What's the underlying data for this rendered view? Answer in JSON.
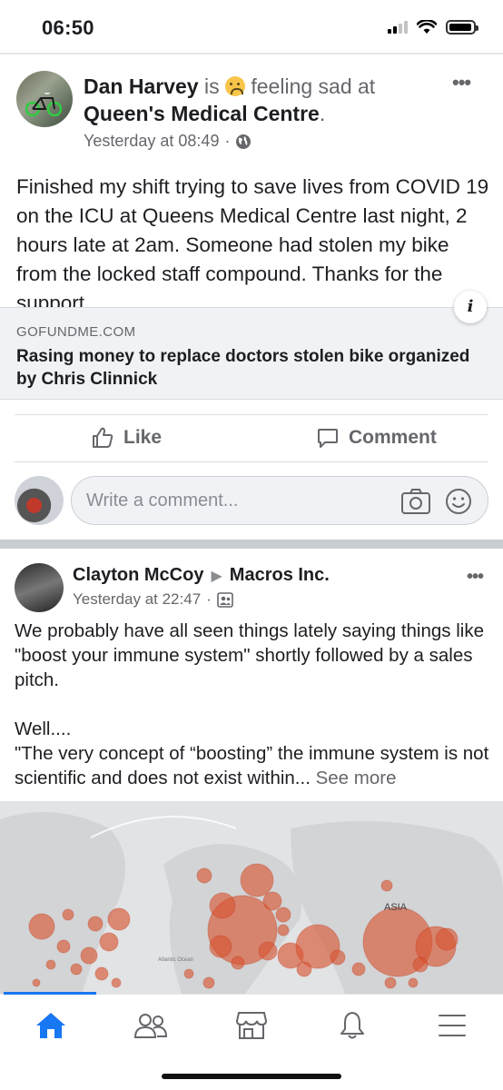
{
  "status_bar": {
    "time": "06:50",
    "battery_level": 0.95
  },
  "post1": {
    "author": "Dan Harvey",
    "is_text": "is",
    "feeling": "feeling sad at",
    "feeling_emoji": "sad-face",
    "location": "Queen's Medical Centre",
    "location_suffix": ".",
    "timestamp": "Yesterday at 08:49",
    "separator": "·",
    "privacy_icon": "globe-icon",
    "body": "Finished my shift trying to save lives from COVID 19 on the ICU at Queens Medical Centre last night, 2 hours late at 2am. Someone had stolen my bike from the locked staff compound. Thanks for the support.",
    "link": {
      "domain": "GOFUNDME.COM",
      "title": "Rasing money to replace doctors stolen bike organized by Chris Clinnick"
    },
    "actions": {
      "like": "Like",
      "comment": "Comment"
    }
  },
  "composer": {
    "placeholder": "Write a comment..."
  },
  "post2": {
    "author": "Clayton McCoy",
    "arrow": "▶",
    "page": "Macros Inc.",
    "timestamp": "Yesterday at 22:47",
    "separator": "·",
    "audience_icon": "group-icon",
    "lines": [
      "We probably have all seen things lately saying things like \"boost your immune system\" shortly followed by a sales pitch.",
      "",
      "Well....",
      "\"The very concept of “boosting” the immune system is not scientific and does not exist within..."
    ],
    "see_more": "See more",
    "map_labels": {
      "asia": "ASIA",
      "ocean": "Atlantic Ocean"
    }
  },
  "bottom_nav": [
    "home-icon",
    "friends-icon",
    "marketplace-icon",
    "notifications-icon",
    "menu-icon"
  ],
  "colors": {
    "accent": "#1877f2",
    "bubble": "#d9532f"
  }
}
